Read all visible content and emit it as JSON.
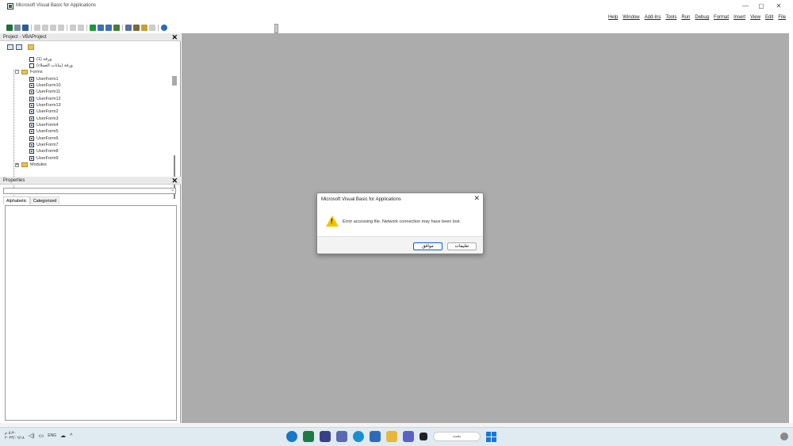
{
  "window": {
    "title": "Microsoft Visual Basic for Applications",
    "controls": {
      "minimize": "—",
      "maximize": "▢",
      "close": "✕"
    }
  },
  "menu": {
    "items": [
      "Help",
      "Window",
      "Add-Ins",
      "Tools",
      "Run",
      "Debug",
      "Format",
      "Insert",
      "View",
      "Edit",
      "File"
    ]
  },
  "project_pane": {
    "title": "Project - VBAProject",
    "close": "✕",
    "tree": [
      {
        "label": "ورقة (1)",
        "kind": "sheet"
      },
      {
        "label": "ورقة (بيانات العملاء)",
        "kind": "sheet"
      },
      {
        "label": "Forms",
        "kind": "folder"
      },
      {
        "label": "UserForm1",
        "kind": "form"
      },
      {
        "label": "UserForm10",
        "kind": "form"
      },
      {
        "label": "UserForm11",
        "kind": "form"
      },
      {
        "label": "UserForm12",
        "kind": "form"
      },
      {
        "label": "UserForm13",
        "kind": "form"
      },
      {
        "label": "UserForm2",
        "kind": "form"
      },
      {
        "label": "UserForm3",
        "kind": "form"
      },
      {
        "label": "UserForm4",
        "kind": "form"
      },
      {
        "label": "UserForm5",
        "kind": "form"
      },
      {
        "label": "UserForm6",
        "kind": "form"
      },
      {
        "label": "UserForm7",
        "kind": "form"
      },
      {
        "label": "UserForm8",
        "kind": "form"
      },
      {
        "label": "UserForm9",
        "kind": "form"
      },
      {
        "label": "Modules",
        "kind": "folder"
      }
    ]
  },
  "properties_pane": {
    "title": "Properties",
    "close": "✕",
    "tabs": [
      "Alphabetic",
      "Categorized"
    ]
  },
  "dialog": {
    "title": "Microsoft Visual Basic for Applications",
    "close": "✕",
    "message": "Error accessing file. Network connection may have been lost.",
    "ok_label": "موافق",
    "help_label": "تعليمات"
  },
  "taskbar": {
    "time": "٥:٣٠ م",
    "date": "٢٠٢٣/٠٦/١٨",
    "lang": "ENG",
    "search": "بحث"
  },
  "colors": {
    "workspace": "#acacac",
    "accent": "#0a5bd6",
    "warning": "#f2c200"
  }
}
